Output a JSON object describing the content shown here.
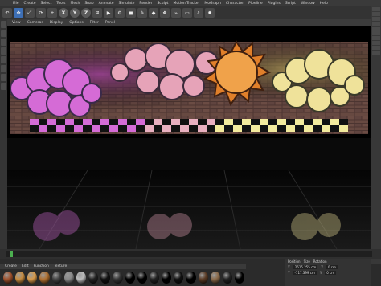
{
  "menu": [
    "File",
    "Create",
    "Select",
    "Tools",
    "Mesh",
    "Snap",
    "Animate",
    "Simulate",
    "Render",
    "Sculpt",
    "Motion Tracker",
    "MoGraph",
    "Character",
    "Pipeline",
    "Plugins",
    "Script",
    "Window",
    "Help"
  ],
  "toolbar": {
    "xyz": [
      "X",
      "Y",
      "Z"
    ]
  },
  "viewport_menu": [
    "View",
    "Cameras",
    "Display",
    "Options",
    "Filter",
    "Panel"
  ],
  "material_menu": [
    "Create",
    "Edit",
    "Function",
    "Texture"
  ],
  "attributes": {
    "headers": [
      "Position",
      "Size",
      "Rotation"
    ],
    "row1": [
      "X",
      "2615.255 cm",
      "X",
      "0 cm",
      "H",
      "0°"
    ],
    "row2": [
      "Y",
      "-117.399 cm",
      "Y",
      "0 cm",
      "P",
      "0°"
    ]
  },
  "materials": [
    "#a0522d",
    "#c68b3e",
    "#d89a4a",
    "#b07030",
    "#444",
    "#888",
    "#bbb",
    "#222",
    "#111",
    "#333",
    "#000",
    "#000",
    "#222",
    "#000",
    "#111",
    "#000",
    "#5a3b25",
    "#8a6a4a",
    "#222",
    "#000"
  ],
  "scene": {
    "left_cloud_color": "#d56bd6",
    "mid_cloud_color": "#e6a3b8",
    "right_cloud_color": "#efe29a",
    "sun_color": "#f0a24a",
    "brick_color": "#6b4b42"
  }
}
